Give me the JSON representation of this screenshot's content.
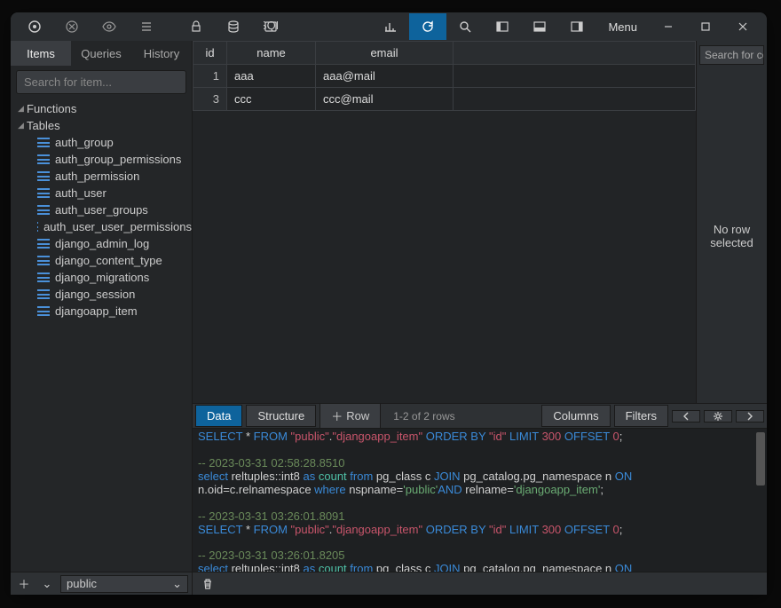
{
  "titlebar": {
    "menu": "Menu"
  },
  "sidebar": {
    "tabs": [
      "Items",
      "Queries",
      "History"
    ],
    "search_placeholder": "Search for item...",
    "functions_label": "Functions",
    "tables_label": "Tables",
    "tables": [
      "auth_group",
      "auth_group_permissions",
      "auth_permission",
      "auth_user",
      "auth_user_groups",
      "auth_user_user_permissions",
      "django_admin_log",
      "django_content_type",
      "django_migrations",
      "django_session",
      "djangoapp_item"
    ],
    "schema": "public"
  },
  "grid": {
    "columns": [
      "id",
      "name",
      "email"
    ],
    "rows": [
      {
        "id": "1",
        "name": "aaa",
        "email": "aaa@mail"
      },
      {
        "id": "3",
        "name": "ccc",
        "email": "ccc@mail"
      }
    ]
  },
  "inspector": {
    "search": "Search for col",
    "none1": "No row",
    "none2": "selected"
  },
  "toolbar": {
    "data": "Data",
    "structure": "Structure",
    "row": "Row",
    "info": "1-2 of 2 rows",
    "columns": "Columns",
    "filters": "Filters"
  },
  "console": {
    "l1a": "SELECT",
    "l1b": " * ",
    "l1c": "FROM",
    "l1d": " \"public\"",
    "l1e": ".",
    "l1f": "\"djangoapp_item\"",
    "l1g": " ORDER BY ",
    "l1h": "\"id\"",
    "l1i": " LIMIT ",
    "l1j": "300",
    "l1k": " OFFSET ",
    "l1l": "0",
    "l1m": ";",
    "c1": "-- 2023-03-31 02:58:28.8510",
    "l2a": "select",
    "l2b": " reltuples::int8 ",
    "l2c": "as",
    "l2d": " count ",
    "l2e": "from",
    "l2f": " pg_class c ",
    "l2g": "JOIN",
    "l2h": " pg_catalog.pg_namespace n ",
    "l2i": "ON",
    "l3a": "n.oid=c.relnamespace ",
    "l3b": "where",
    "l3c": " nspname=",
    "l3d": "'public'",
    "l3e": "AND",
    "l3f": " relname=",
    "l3g": "'djangoapp_item'",
    "l3h": ";",
    "c2": "-- 2023-03-31 03:26:01.8091",
    "c3": "-- 2023-03-31 03:26:01.8205"
  }
}
